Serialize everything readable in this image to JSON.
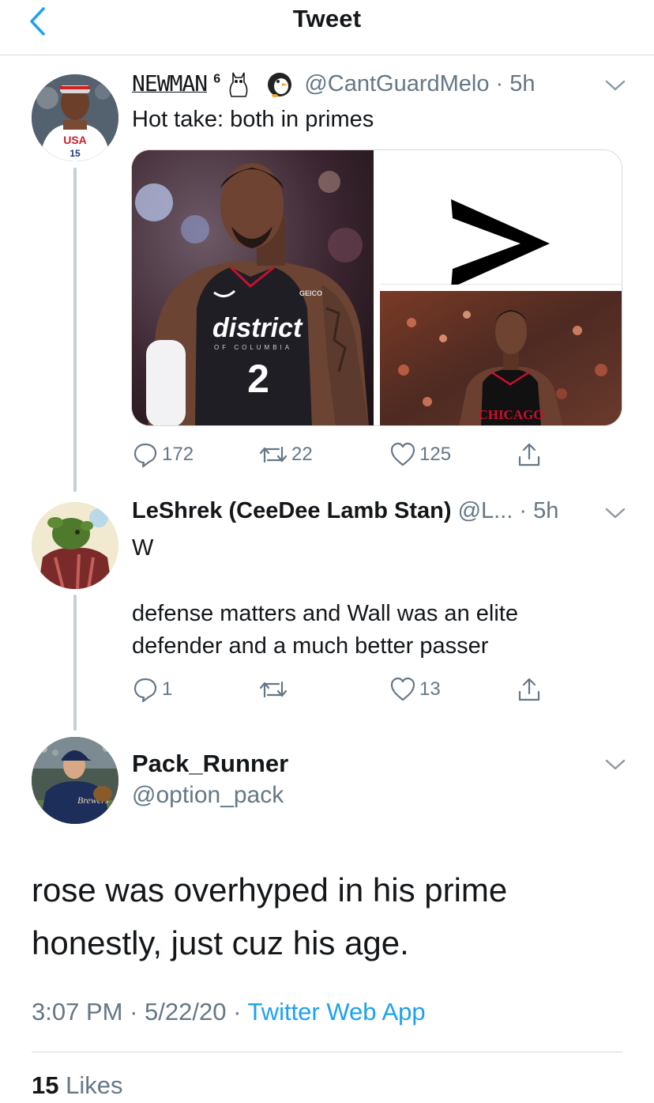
{
  "nav": {
    "title": "Tweet"
  },
  "tweet1": {
    "name": "NEWMAN",
    "name_suffix": "6",
    "handle": "@CantGuardMelo",
    "time": "5h",
    "text": "Hot take: both in primes",
    "media": {
      "jersey_left": "district",
      "jersey_sub": "OF COLUMBIA",
      "number": "2",
      "sponsor": "GEICO",
      "arrow": ">",
      "jersey_right": "CHICAGO",
      "avatar_jersey": "USA"
    },
    "replies": "172",
    "retweets": "22",
    "likes": "125"
  },
  "tweet2": {
    "name": "LeShrek (CeeDee Lamb Stan)",
    "handle": "@L...",
    "time": "5h",
    "line1": "W",
    "line2": "defense matters and Wall was an elite",
    "line3": "defender and a much better passer",
    "replies": "1",
    "retweets": "",
    "likes": "13"
  },
  "main": {
    "name": "Pack_Runner",
    "handle": "@option_pack",
    "line1": "rose was overhyped in his prime",
    "line2": "honestly, just cuz his age.",
    "time": "3:07 PM",
    "date": "5/22/20",
    "app": "Twitter Web App",
    "likes_count": "15",
    "likes_label": "Likes"
  },
  "colors": {
    "link": "#1da1f2",
    "secondary": "#657786",
    "thread": "#c4cfd6"
  }
}
